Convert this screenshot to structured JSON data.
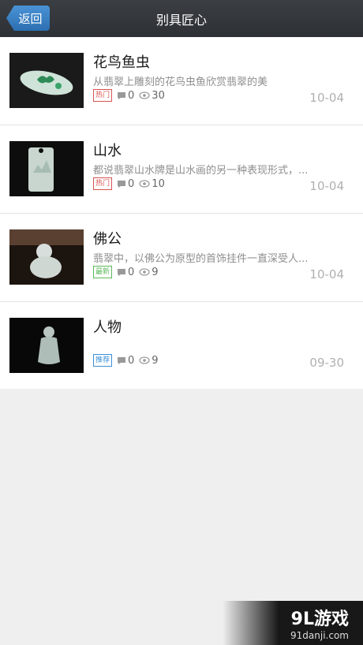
{
  "header": {
    "back_label": "返回",
    "title": "别具匠心"
  },
  "items": [
    {
      "title": "花鸟鱼虫",
      "summary": "从翡翠上雕刻的花鸟虫鱼欣赏翡翠的美",
      "tag": "热门",
      "comments": "0",
      "views": "30",
      "date": "10-04"
    },
    {
      "title": "山水",
      "summary": "都说翡翠山水牌是山水画的另一种表现形式，...",
      "tag": "热门",
      "comments": "0",
      "views": "10",
      "date": "10-04"
    },
    {
      "title": "佛公",
      "summary": "翡翠中，以佛公为原型的首饰挂件一直深受人...",
      "tag": "最新",
      "comments": "0",
      "views": "9",
      "date": "10-04"
    },
    {
      "title": "人物",
      "summary": "",
      "tag": "推荐",
      "comments": "0",
      "views": "9",
      "date": "09-30"
    }
  ],
  "watermark": {
    "logo": "9L游戏",
    "url": "91danji.com"
  },
  "colors": {
    "header_bg": "#2d3035",
    "back_button": "#3a85cc",
    "tag_hot": "#d9534f",
    "tag_new": "#5cb85c",
    "tag_recommend": "#3a8fd6"
  }
}
